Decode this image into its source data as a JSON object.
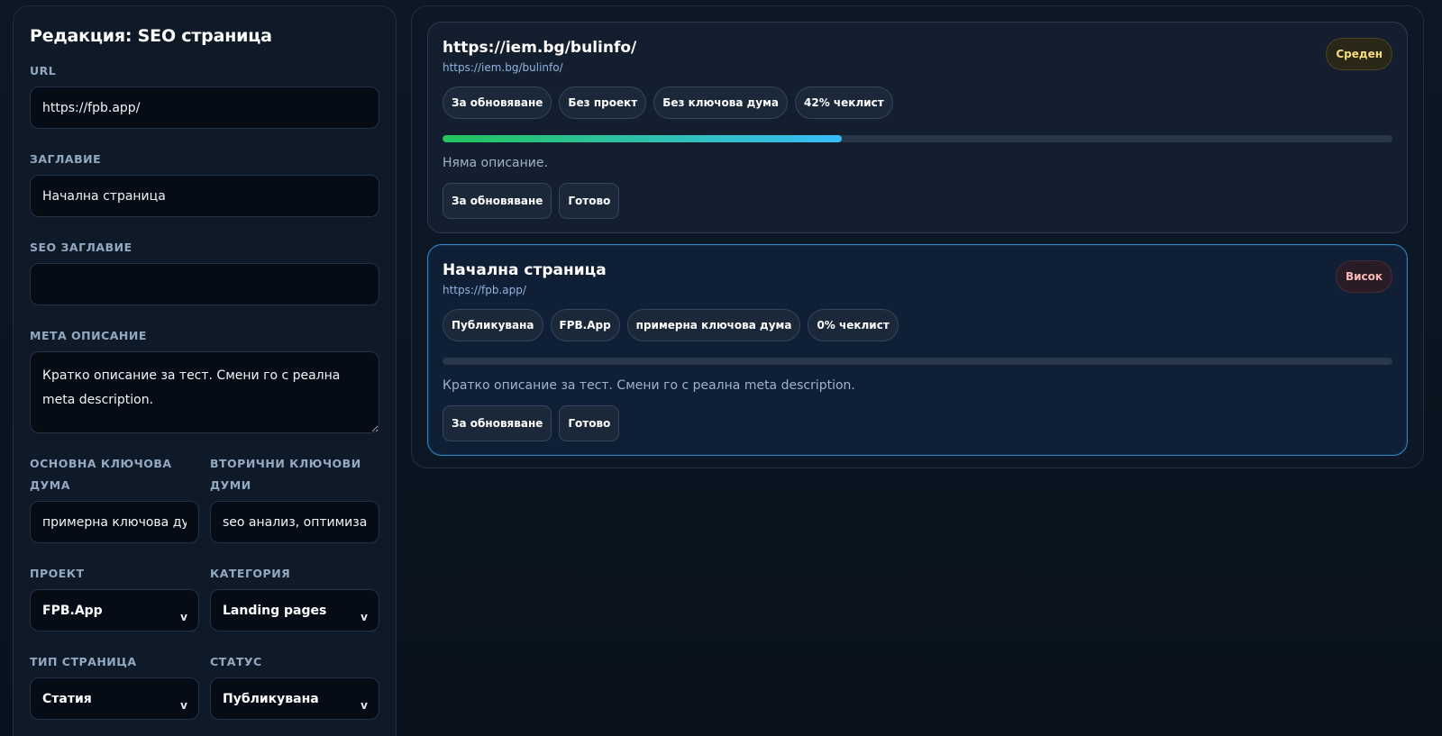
{
  "editor": {
    "title": "Редакция: SEO страница",
    "url": {
      "label": "URL",
      "value": "https://fpb.app/"
    },
    "title_field": {
      "label": "Заглавие",
      "value": "Начална страница"
    },
    "seo_title": {
      "label": "SEO заглавие",
      "value": ""
    },
    "meta_description": {
      "label": "Мета описание",
      "value": "Кратко описание за тест. Смени го с реална meta description."
    },
    "primary_keyword": {
      "label": "Основна ключова дума",
      "value": "примерна ключова дума"
    },
    "secondary_keywords": {
      "label": "Вторични ключови думи",
      "value": "seo анализ, оптимизация"
    },
    "project": {
      "label": "Проект",
      "value": "FPB.App"
    },
    "category": {
      "label": "Категория",
      "value": "Landing pages"
    },
    "page_type": {
      "label": "Тип страница",
      "value": "Статия"
    },
    "status": {
      "label": "Статус",
      "value": "Публикувана"
    },
    "chevron": "v"
  },
  "pages": [
    {
      "title": "https://iem.bg/bulinfo/",
      "url": "https://iem.bg/bulinfo/",
      "priority": "Среден",
      "chips": [
        "За обновяване",
        "Без проект",
        "Без ключова дума",
        "42% чеклист"
      ],
      "checklist_progress": 0.42,
      "description": "Няма описание.",
      "actions": [
        "За обновяване",
        "Готово"
      ]
    },
    {
      "title": "Начална страница",
      "url": "https://fpb.app/",
      "priority": "Висок",
      "chips": [
        "Публикувана",
        "FPB.App",
        "примерна ключова дума",
        "0% чеклист"
      ],
      "checklist_progress": 0,
      "description": "Кратко описание за тест. Смени го с реална meta description.",
      "actions": [
        "За обновяване",
        "Готово"
      ]
    }
  ],
  "colors": {
    "priority_medium": "#f7dd7a",
    "priority_high": "#fab6b6",
    "progress_start": "#22c55e",
    "progress_end": "#38bdf8",
    "selected_border": "#2f86c3"
  }
}
